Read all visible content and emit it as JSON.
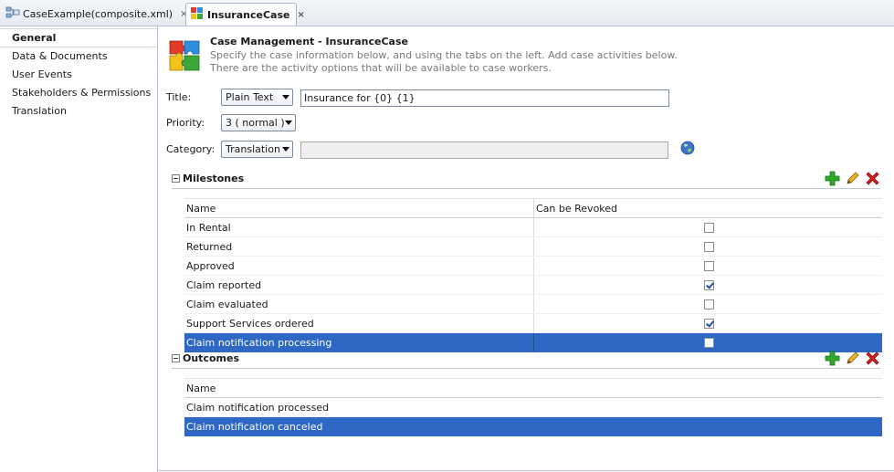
{
  "tabs": [
    {
      "label": "CaseExample(composite.xml)",
      "close": "×",
      "active": false
    },
    {
      "label": "InsuranceCase",
      "close": "×",
      "active": true
    }
  ],
  "nav": {
    "items": [
      {
        "label": "General",
        "selected": true
      },
      {
        "label": "Data & Documents",
        "selected": false
      },
      {
        "label": "User Events",
        "selected": false
      },
      {
        "label": "Stakeholders & Permissions",
        "selected": false
      },
      {
        "label": "Translation",
        "selected": false
      }
    ]
  },
  "header": {
    "title": "Case Management - InsuranceCase",
    "desc_line1": "Specify the case information below, and using the tabs on the left. Add case activities below.",
    "desc_line2": "There are the activity options that will be available to case workers."
  },
  "form": {
    "title_label": "Title:",
    "title_type": "Plain Text",
    "title_value": "Insurance for {0} {1}",
    "priority_label": "Priority:",
    "priority_value": "3 ( normal )",
    "category_label": "Category:",
    "category_type": "Translation",
    "category_value": ""
  },
  "milestones": {
    "title": "Milestones",
    "col_name": "Name",
    "col_revoked": "Can be Revoked",
    "rows": [
      {
        "name": "In Rental",
        "revoked": false,
        "selected": false
      },
      {
        "name": "Returned",
        "revoked": false,
        "selected": false
      },
      {
        "name": "Approved",
        "revoked": false,
        "selected": false
      },
      {
        "name": "Claim reported",
        "revoked": true,
        "selected": false
      },
      {
        "name": "Claim evaluated",
        "revoked": false,
        "selected": false
      },
      {
        "name": "Support Services ordered",
        "revoked": true,
        "selected": false
      },
      {
        "name": "Claim notification processing",
        "revoked": false,
        "selected": true
      }
    ]
  },
  "outcomes": {
    "title": "Outcomes",
    "col_name": "Name",
    "rows": [
      {
        "name": "Claim notification processed",
        "selected": false
      },
      {
        "name": "Claim notification canceled",
        "selected": true
      }
    ]
  },
  "icons": {
    "add": "add-icon",
    "edit": "edit-icon",
    "delete": "delete-icon",
    "globe": "globe-icon",
    "puzzle": "puzzle-icon"
  },
  "colors": {
    "selection": "#2f68c4",
    "add": "#2ea82e",
    "delete": "#d42020",
    "edit": "#d8a21e"
  }
}
